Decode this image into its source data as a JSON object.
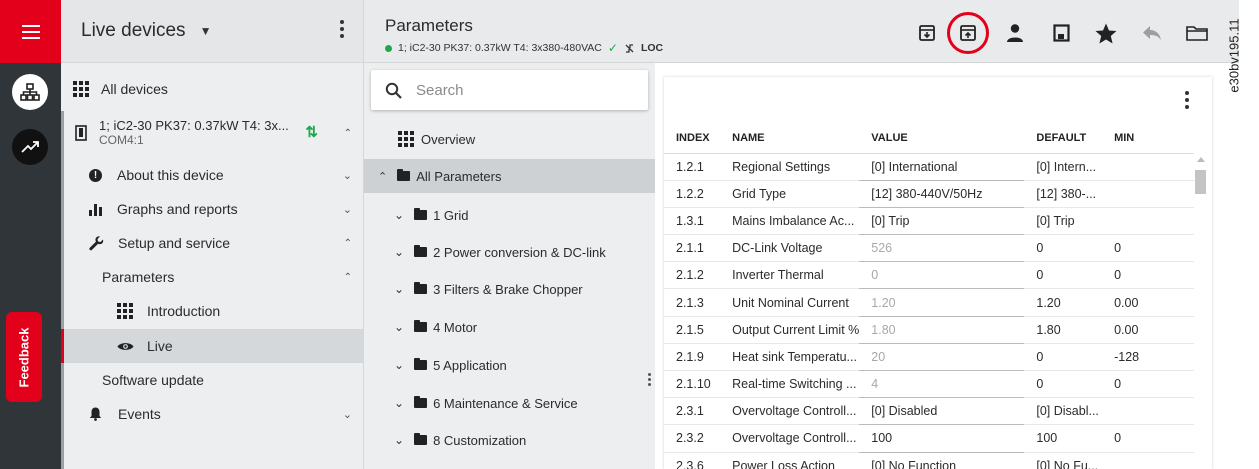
{
  "nav": {
    "title": "Live devices",
    "all_devices": "All devices",
    "device": {
      "name": "1; iC2-30 PK37: 0.37kW T4: 3x...",
      "port": "COM4:1"
    },
    "items": [
      {
        "label": "About this device"
      },
      {
        "label": "Graphs and reports"
      },
      {
        "label": "Setup and service"
      },
      {
        "label": "Parameters"
      },
      {
        "label": "Introduction"
      },
      {
        "label": "Live"
      },
      {
        "label": "Software update"
      },
      {
        "label": "Events"
      }
    ]
  },
  "feedback": "Feedback",
  "header": {
    "title": "Parameters",
    "subtitle": "1; iC2-30 PK37: 0.37kW T4: 3x380-480VAC",
    "mode": "LOC",
    "toolbar_icons": [
      "import-icon",
      "export-icon",
      "user-icon",
      "save-icon",
      "favorite-icon",
      "back-icon",
      "folder-icon"
    ]
  },
  "side_code": "e30bv195.11",
  "tree": {
    "search_placeholder": "Search",
    "overview": "Overview",
    "all_parameters": "All Parameters",
    "groups": [
      "1 Grid",
      "2 Power conversion & DC-link",
      "3 Filters & Brake Chopper",
      "4 Motor",
      "5 Application",
      "6 Maintenance & Service",
      "8 Customization"
    ]
  },
  "table": {
    "columns": [
      "INDEX",
      "NAME",
      "VALUE",
      "DEFAULT",
      "MIN"
    ],
    "rows": [
      [
        "1.2.1",
        "Regional Settings",
        "[0] International",
        "[0] Intern...",
        ""
      ],
      [
        "1.2.2",
        "Grid Type",
        "[12] 380-440V/50Hz",
        "[12] 380-...",
        ""
      ],
      [
        "1.3.1",
        "Mains Imbalance Ac...",
        "[0] Trip",
        "[0] Trip",
        ""
      ],
      [
        "2.1.1",
        "DC-Link Voltage",
        "526",
        "0",
        "0"
      ],
      [
        "2.1.2",
        "Inverter Thermal",
        "0",
        "0",
        "0"
      ],
      [
        "2.1.3",
        "Unit Nominal Current",
        "1.20",
        "1.20",
        "0.00"
      ],
      [
        "2.1.5",
        "Output Current Limit %",
        "1.80",
        "1.80",
        "0.00"
      ],
      [
        "2.1.9",
        "Heat sink Temperatu...",
        "20",
        "0",
        "-128"
      ],
      [
        "2.1.10",
        "Real-time Switching ...",
        "4",
        "0",
        "0"
      ],
      [
        "2.3.1",
        "Overvoltage Controll...",
        "[0] Disabled",
        "[0] Disabl...",
        ""
      ],
      [
        "2.3.2",
        "Overvoltage Controll...",
        "100",
        "100",
        "0"
      ],
      [
        "2.3.6",
        "Power Loss Action",
        "[0] No Function",
        "[0] No Fu...",
        ""
      ]
    ],
    "readonly_rows": [
      3,
      4,
      5,
      6,
      7,
      8
    ]
  },
  "colors": {
    "brand": "#e2001a",
    "online": "#1ea84a",
    "sidebar": "#2f3538"
  }
}
